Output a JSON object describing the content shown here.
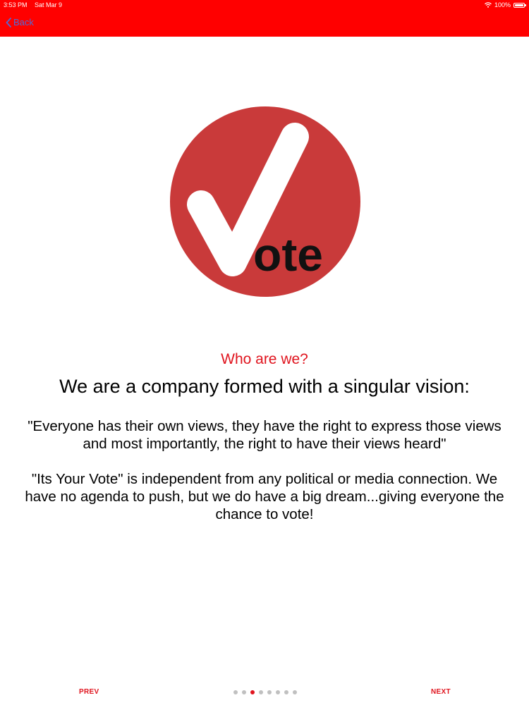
{
  "status_bar": {
    "time": "3:53 PM",
    "date": "Sat Mar 9",
    "battery_text": "100%",
    "battery_level": 1.0
  },
  "nav": {
    "back_label": "Back"
  },
  "logo": {
    "text": "ote"
  },
  "content": {
    "subtitle": "Who are we?",
    "headline": "We are a company formed with a singular vision:",
    "quote": "\"Everyone has their own views, they have the right to express those views and most importantly, the right to have their views heard\"",
    "paragraph": "\"Its Your Vote\" is independent from any political or media connection. We have no agenda to push,  but we do have a big dream...giving everyone the chance to vote!"
  },
  "pager": {
    "prev_label": "PREV",
    "next_label": "NEXT",
    "page_count": 8,
    "current_page": 3
  },
  "colors": {
    "nav_bar": "#ff0000",
    "accent": "#e0141e",
    "logo_circle": "#c93a3a",
    "back_link": "#4f6bd8"
  }
}
